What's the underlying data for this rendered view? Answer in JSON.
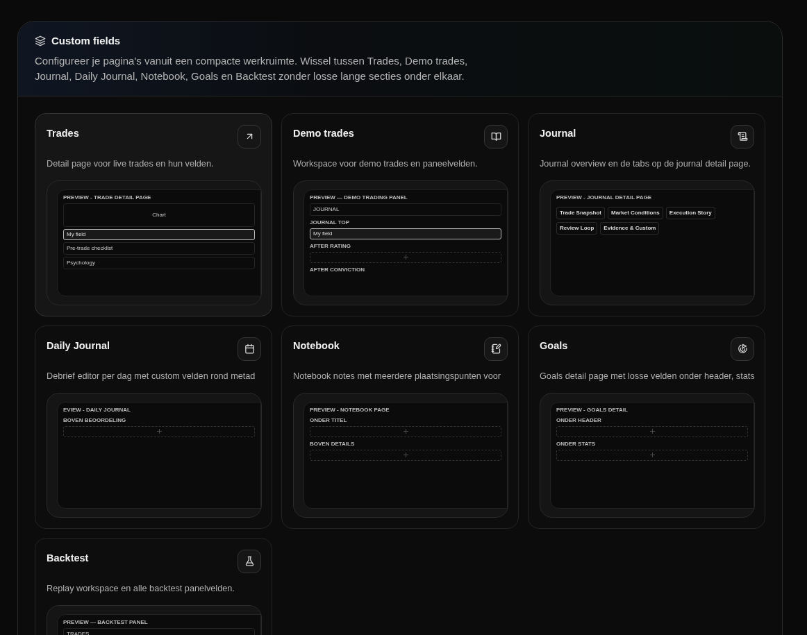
{
  "header": {
    "title": "Custom fields",
    "description": "Configureer je pagina's vanuit een compacte werkruimte. Wissel tussen Trades, Demo trades, Journal, Daily Journal, Notebook, Goals en Backtest zonder losse lange secties onder elkaar."
  },
  "cards": [
    {
      "title": "Trades",
      "selected": true,
      "description": "Detail page voor live trades en hun velden.",
      "preview": {
        "title": "PREVIEW - TRADE DETAIL PAGE",
        "sections": [
          {
            "kind": "chart",
            "label": "Chart"
          },
          {
            "kind": "field",
            "label": "My field"
          },
          {
            "kind": "text",
            "label": "Pre-trade checklist"
          },
          {
            "kind": "text",
            "label": "Psychology"
          }
        ]
      }
    },
    {
      "title": "Demo trades",
      "selected": false,
      "description": "Workspace voor demo trades en paneelvelden.",
      "preview": {
        "title": "PREVIEW — DEMO TRADING PANEL",
        "sections": [
          {
            "kind": "text",
            "label": "JOURNAL"
          },
          {
            "kind": "label",
            "label": "JOURNAL TOP"
          },
          {
            "kind": "field",
            "label": "My field"
          },
          {
            "kind": "label",
            "label": "AFTER RATING"
          },
          {
            "kind": "dropzone"
          },
          {
            "kind": "label",
            "label": "AFTER CONVICTION"
          }
        ]
      }
    },
    {
      "title": "Journal",
      "selected": false,
      "description": "Journal overview en de tabs op de journal detail page.",
      "preview": {
        "title": "PREVIEW - JOURNAL DETAIL PAGE",
        "sections": [
          {
            "kind": "tabs",
            "label": "Trade Snapshot"
          },
          {
            "kind": "tabs",
            "label": "Market Conditions"
          },
          {
            "kind": "tabs",
            "label": "Execution Story"
          },
          {
            "kind": "tabs",
            "label": "Review Loop"
          },
          {
            "kind": "tabs",
            "label": "Evidence & Custom"
          }
        ]
      }
    },
    {
      "title": "Daily Journal",
      "selected": false,
      "description": "Debrief editor per dag met custom velden rond metad",
      "preview": {
        "title": "EVIEW - DAILY JOURNAL",
        "sections": [
          {
            "kind": "label",
            "label": "BOVEN BEOORDELING"
          },
          {
            "kind": "dropzone"
          }
        ]
      }
    },
    {
      "title": "Notebook",
      "selected": false,
      "description": "Notebook notes met meerdere plaatsingspunten voor",
      "preview": {
        "title": "PREVIEW - NOTEBOOK PAGE",
        "sections": [
          {
            "kind": "label",
            "label": "ONDER TITEL"
          },
          {
            "kind": "dropzone"
          },
          {
            "kind": "label",
            "label": "BOVEN DETAILS"
          },
          {
            "kind": "dropzone"
          }
        ]
      }
    },
    {
      "title": "Goals",
      "selected": false,
      "description": "Goals detail page met losse velden onder header, stats",
      "preview": {
        "title": "PREVIEW - GOALS DETAIL",
        "sections": [
          {
            "kind": "label",
            "label": "ONDER HEADER"
          },
          {
            "kind": "dropzone"
          },
          {
            "kind": "label",
            "label": "ONDER STATS"
          },
          {
            "kind": "dropzone"
          }
        ]
      }
    },
    {
      "title": "Backtest",
      "selected": false,
      "description": "Replay workspace en alle backtest panelvelden.",
      "preview": {
        "title": "PREVIEW — BACKTEST PANEL",
        "sections": [
          {
            "kind": "text",
            "label": "TRADES"
          }
        ]
      }
    }
  ]
}
